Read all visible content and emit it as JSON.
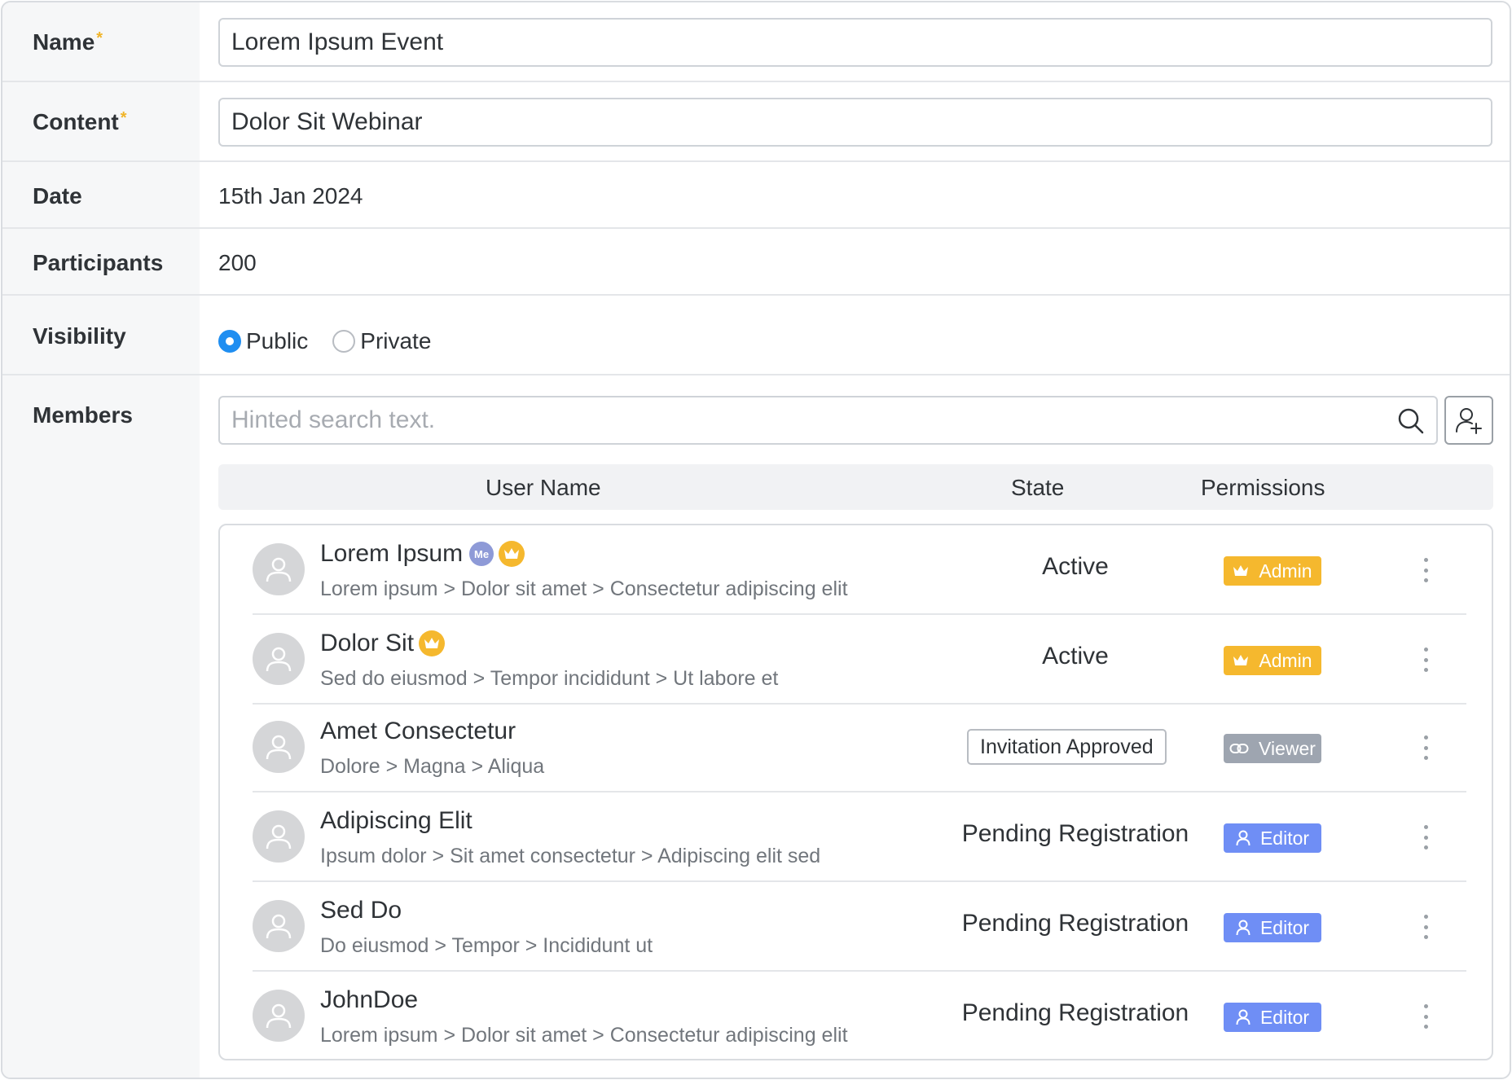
{
  "form": {
    "name": {
      "label": "Name",
      "required_mark": "*",
      "value": "Lorem Ipsum Event"
    },
    "content": {
      "label": "Content",
      "required_mark": "*",
      "value": "Dolor Sit Webinar"
    },
    "date": {
      "label": "Date",
      "value": "15th Jan 2024"
    },
    "participants": {
      "label": "Participants",
      "value": "200"
    },
    "visibility": {
      "label": "Visibility",
      "options": [
        "Public",
        "Private"
      ],
      "selected": "Public"
    },
    "members": {
      "label": "Members"
    }
  },
  "search": {
    "placeholder": "Hinted search text."
  },
  "table": {
    "headers": {
      "user_name": "User Name",
      "state": "State",
      "permissions": "Permissions"
    }
  },
  "members": [
    {
      "name": "Lorem Ipsum",
      "me_badge": "Me",
      "crown": true,
      "path": "Lorem ipsum > Dolor sit amet > Consectetur adipiscing elit",
      "state": "Active",
      "permission": "Admin",
      "permission_icon": "crown-icon"
    },
    {
      "name": "Dolor Sit",
      "crown": true,
      "path": "Sed do eiusmod > Tempor incididunt > Ut labore et",
      "state": "Active",
      "permission": "Admin",
      "permission_icon": "crown-icon"
    },
    {
      "name": "Amet Consectetur",
      "path": " Dolore > Magna > Aliqua",
      "state": "Invitation Approved",
      "state_boxed": true,
      "permission": "Viewer",
      "permission_icon": "link-icon"
    },
    {
      "name": "Adipiscing Elit",
      "path": "Ipsum dolor > Sit amet consectetur > Adipiscing elit sed",
      "state": "Pending Registration",
      "permission": "Editor",
      "permission_icon": "user-icon"
    },
    {
      "name": "Sed Do",
      "path": "Do eiusmod > Tempor > Incididunt ut",
      "state": "Pending Registration",
      "permission": "Editor",
      "permission_icon": "user-icon"
    },
    {
      "name": "JohnDoe",
      "path": "Lorem ipsum > Dolor sit amet > Consectetur adipiscing elit",
      "state": "Pending Registration",
      "permission": "Editor",
      "permission_icon": "user-icon"
    }
  ],
  "colors": {
    "required": "#f0b429",
    "radio_active": "#1f8ef1",
    "admin": "#f5b82e",
    "viewer": "#9ea5b0",
    "editor": "#6f8ef5",
    "me_badge": "#8e9ad7"
  }
}
